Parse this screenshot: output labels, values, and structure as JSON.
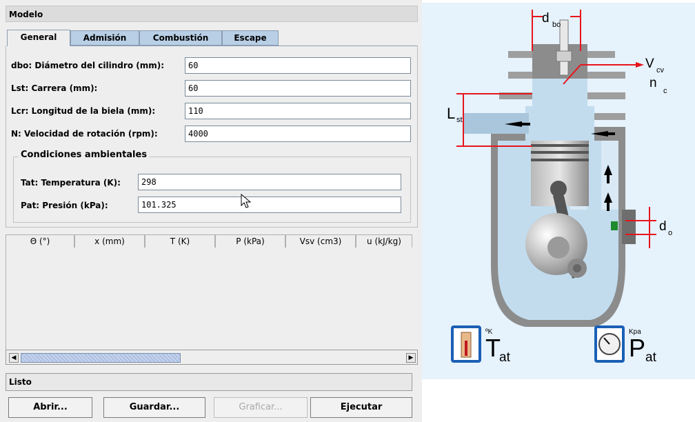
{
  "window": {
    "title": "Modelo"
  },
  "tabs": [
    {
      "label": "General",
      "active": true
    },
    {
      "label": "Admisión",
      "active": false
    },
    {
      "label": "Combustión",
      "active": false
    },
    {
      "label": "Escape",
      "active": false
    }
  ],
  "general": {
    "dbo": {
      "label": "dbo: Diámetro del cilindro (mm):",
      "value": "60"
    },
    "lst": {
      "label": "Lst: Carrera (mm):",
      "value": "60"
    },
    "lcr": {
      "label": "Lcr: Longitud de la biela (mm):",
      "value": "110"
    },
    "rpm": {
      "label": "N: Velocidad de rotación (rpm):",
      "value": "4000"
    }
  },
  "ambient": {
    "title": "Condiciones ambientales",
    "tat": {
      "label": "Tat: Temperatura (K):",
      "value": "298"
    },
    "pat": {
      "label": "Pat: Presión (kPa):",
      "value": "101.325"
    }
  },
  "table": {
    "columns": [
      "Θ (°)",
      "x (mm)",
      "T (K)",
      "P (kPa)",
      "Vsv (cm3)",
      "u (kJ/kg)"
    ],
    "rows": []
  },
  "status": {
    "text": "Listo"
  },
  "buttons": {
    "open": "Abrir...",
    "save": "Guardar...",
    "plot": "Graficar...",
    "run": "Ejecutar"
  },
  "diagram": {
    "labels": {
      "dbo_main": "d",
      "dbo_sub": "bo",
      "vcv_main": "V",
      "vcv_sub": "cv",
      "nc_main": "n",
      "nc_sub": "c",
      "lst_main": "L",
      "lst_sub": "st",
      "do_main": "d",
      "do_sub": "o",
      "tat_unit": "ºK",
      "tat_main": "T",
      "tat_sub": "at",
      "pat_unit": "Kpa",
      "pat_main": "P",
      "pat_sub": "at"
    },
    "colors": {
      "background": "#e6f2fc",
      "engine_metal": "#8c8c8c",
      "dimension_lines": "#e8141c",
      "icon_frame": "#1a5fb4"
    }
  }
}
